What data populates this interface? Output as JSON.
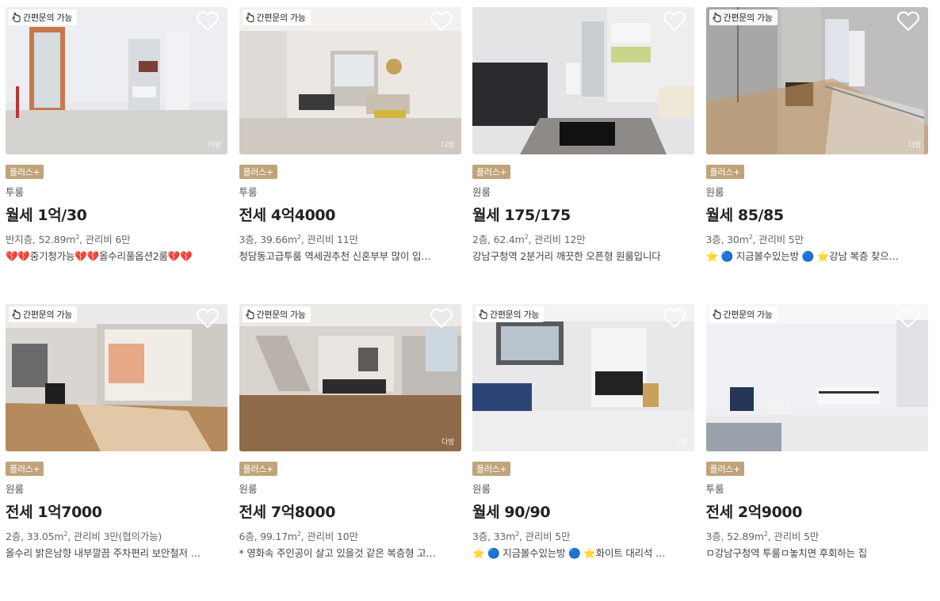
{
  "quick_inquiry_label": "간편문의 가능",
  "plus_label": "플러스+",
  "watermark": "다방",
  "accent_color": "#bfa47a",
  "listings": [
    {
      "room_type": "투룸",
      "price": "월세 1억/30",
      "floor": "반지층",
      "area": "52.89m",
      "area_unit": "2",
      "fee": ", 관리비 6만",
      "desc": "💔💔중기청가능💔💔올수리풀옵션2룸💔💔"
    },
    {
      "room_type": "투룸",
      "price": "전세 4억4000",
      "floor": "3층",
      "area": "39.66m",
      "area_unit": "2",
      "fee": ", 관리비 11만",
      "desc": "청담동고급투룸 역세권추천 신혼부부 많이 입…"
    },
    {
      "room_type": "원룸",
      "price": "월세 175/175",
      "floor": "2층",
      "area": "62.4m",
      "area_unit": "2",
      "fee": ", 관리비 12만",
      "desc": "강남구청역 2분거리 깨끗한 오픈형 원룸입니다"
    },
    {
      "room_type": "원룸",
      "price": "월세 85/85",
      "floor": "3층",
      "area": "30m",
      "area_unit": "2",
      "fee": ", 관리비 5만",
      "desc": "⭐ 🔵 지금볼수있는방 🔵 ⭐강남 복층 찾으…"
    },
    {
      "room_type": "원룸",
      "price": "전세 1억7000",
      "floor": "2층",
      "area": "33.05m",
      "area_unit": "2",
      "fee": ", 관리비 3만(협의가능)",
      "desc": "올수리 밝은남향 내부깔끔 주차편리 보안철저 …"
    },
    {
      "room_type": "원룸",
      "price": "전세 7억8000",
      "floor": "6층",
      "area": "99.17m",
      "area_unit": "2",
      "fee": ", 관리비 10만",
      "desc": "* 영화속 주인공이 살고 있을것 같은 복층형 고…"
    },
    {
      "room_type": "원룸",
      "price": "월세 90/90",
      "floor": "3층",
      "area": "33m",
      "area_unit": "2",
      "fee": ", 관리비 5만",
      "desc": "⭐ 🔵 지금볼수있는방 🔵 ⭐화이트 대리석 …"
    },
    {
      "room_type": "투룸",
      "price": "전세 2억9000",
      "floor": "3층",
      "area": "52.89m",
      "area_unit": "2",
      "fee": ", 관리비 5만",
      "desc": "ㅁ강남구청역 투룸ㅁ놓치면 후회하는 집"
    }
  ]
}
